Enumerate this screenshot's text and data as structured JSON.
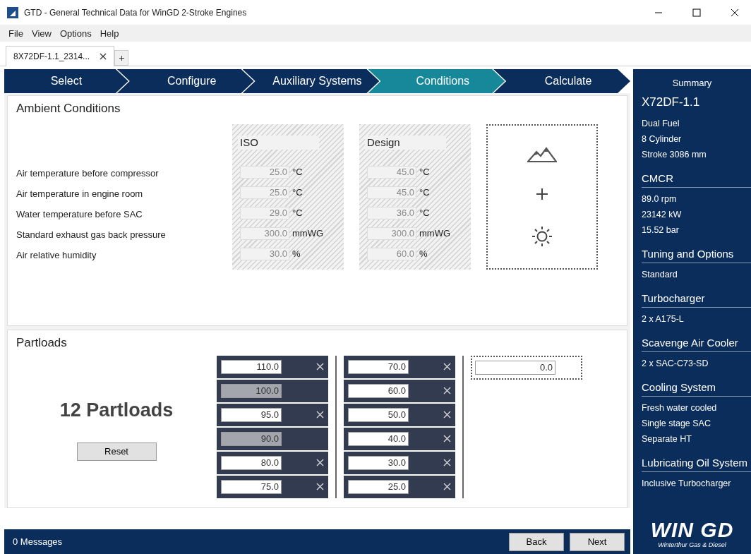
{
  "window": {
    "title": "GTD - General Technical Data for WinGD 2-Stroke Engines"
  },
  "menu": [
    "File",
    "View",
    "Options",
    "Help"
  ],
  "document_tabs": [
    {
      "label": "8X72DF-1.1_2314...",
      "selected": true
    }
  ],
  "steps": [
    {
      "label": "Select",
      "selected": false
    },
    {
      "label": "Configure",
      "selected": false
    },
    {
      "label": "Auxiliary Systems",
      "selected": false
    },
    {
      "label": "Conditions",
      "selected": true
    },
    {
      "label": "Calculate",
      "selected": false
    }
  ],
  "ambient": {
    "title": "Ambient Conditions",
    "columns": [
      "ISO",
      "Design"
    ],
    "rows": [
      {
        "label": "Air temperature before compressor",
        "iso": {
          "value": "25.0",
          "unit": "°C"
        },
        "design": {
          "value": "45.0",
          "unit": "°C"
        }
      },
      {
        "label": "Air temperature in engine room",
        "iso": {
          "value": "25.0",
          "unit": "°C"
        },
        "design": {
          "value": "45.0",
          "unit": "°C"
        }
      },
      {
        "label": "Water temperature before SAC",
        "iso": {
          "value": "29.0",
          "unit": "°C"
        },
        "design": {
          "value": "36.0",
          "unit": "°C"
        }
      },
      {
        "label": "Standard exhaust gas back pressure",
        "iso": {
          "value": "300.0",
          "unit": "mmWG"
        },
        "design": {
          "value": "300.0",
          "unit": "mmWG"
        }
      },
      {
        "label": "Air relative humidity",
        "iso": {
          "value": "30.0",
          "unit": "%"
        },
        "design": {
          "value": "60.0",
          "unit": "%"
        }
      }
    ]
  },
  "partloads": {
    "title": "Partloads",
    "count": "12 Partloads",
    "reset": "Reset",
    "columns": [
      [
        {
          "value": "110.0",
          "disabled": false
        },
        {
          "value": "100.0",
          "disabled": true
        },
        {
          "value": "95.0",
          "disabled": false
        },
        {
          "value": "90.0",
          "disabled": true
        },
        {
          "value": "80.0",
          "disabled": false
        },
        {
          "value": "75.0",
          "disabled": false
        }
      ],
      [
        {
          "value": "70.0",
          "disabled": false
        },
        {
          "value": "60.0",
          "disabled": false
        },
        {
          "value": "50.0",
          "disabled": false
        },
        {
          "value": "40.0",
          "disabled": false
        },
        {
          "value": "30.0",
          "disabled": false
        },
        {
          "value": "25.0",
          "disabled": false
        }
      ]
    ],
    "new_value": "0.0"
  },
  "summary": {
    "title": "Summary",
    "sections": [
      {
        "kind": "engine",
        "heading": "X72DF-1.1",
        "lines": [
          "Dual Fuel",
          "8 Cylinder",
          "Stroke 3086 mm"
        ]
      },
      {
        "kind": "group",
        "heading": "CMCR",
        "lines": [
          "89.0 rpm",
          "23142 kW",
          "15.52 bar"
        ]
      },
      {
        "kind": "group",
        "heading": "Tuning and Options",
        "lines": [
          "Standard"
        ]
      },
      {
        "kind": "group",
        "heading": "Turbocharger",
        "lines": [
          "2 x A175-L"
        ]
      },
      {
        "kind": "group",
        "heading": "Scavenge Air Cooler",
        "lines": [
          "2 x SAC-C73-SD"
        ]
      },
      {
        "kind": "group",
        "heading": "Cooling System",
        "lines": [
          "Fresh water cooled",
          "Single stage SAC",
          "Separate HT"
        ]
      },
      {
        "kind": "group",
        "heading": "Lubricating Oil System",
        "lines": [
          "Inclusive Turbocharger"
        ]
      }
    ],
    "logo": "WIN GD",
    "logo_subtitle": "Winterthur Gas & Diesel"
  },
  "status_bar": {
    "messages": "0 Messages",
    "buttons": [
      "Back",
      "Next"
    ]
  }
}
